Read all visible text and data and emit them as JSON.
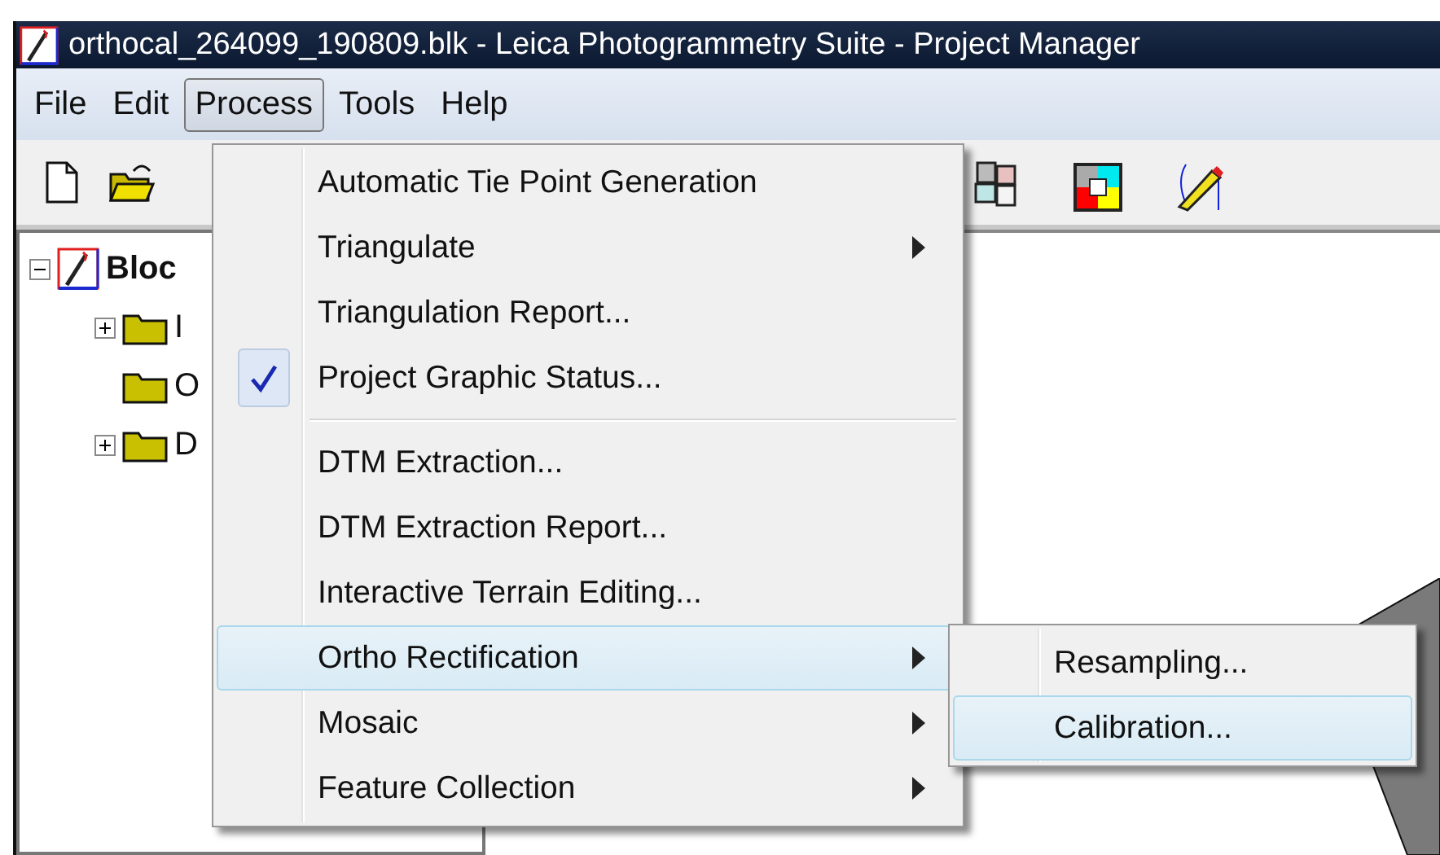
{
  "window": {
    "title": "orthocal_264099_190809.blk - Leica Photogrammetry Suite - Project Manager"
  },
  "menubar": [
    {
      "label": "File",
      "selected": false
    },
    {
      "label": "Edit",
      "selected": false
    },
    {
      "label": "Process",
      "selected": true
    },
    {
      "label": "Tools",
      "selected": false
    },
    {
      "label": "Help",
      "selected": false
    }
  ],
  "tree": {
    "label": "Bloc",
    "expanded": true,
    "children": [
      {
        "label": "I",
        "expanded": false,
        "has_children": true
      },
      {
        "label": "O",
        "has_children": false
      },
      {
        "label": "D",
        "expanded": false,
        "has_children": true
      }
    ]
  },
  "process_menu": [
    {
      "kind": "item",
      "label": "Automatic Tie Point Generation",
      "checked": false,
      "submenu": false,
      "selected": false
    },
    {
      "kind": "item",
      "label": "Triangulate",
      "checked": false,
      "submenu": true,
      "selected": false
    },
    {
      "kind": "item",
      "label": "Triangulation Report...",
      "checked": false,
      "submenu": false,
      "selected": false
    },
    {
      "kind": "item",
      "label": "Project Graphic Status...",
      "checked": true,
      "submenu": false,
      "selected": false
    },
    {
      "kind": "separator"
    },
    {
      "kind": "item",
      "label": "DTM Extraction...",
      "checked": false,
      "submenu": false,
      "selected": false
    },
    {
      "kind": "item",
      "label": "DTM Extraction Report...",
      "checked": false,
      "submenu": false,
      "selected": false
    },
    {
      "kind": "item",
      "label": "Interactive Terrain Editing...",
      "checked": false,
      "submenu": false,
      "selected": false
    },
    {
      "kind": "item",
      "label": "Ortho Rectification",
      "checked": false,
      "submenu": true,
      "selected": true
    },
    {
      "kind": "item",
      "label": "Mosaic",
      "checked": false,
      "submenu": true,
      "selected": false
    },
    {
      "kind": "item",
      "label": "Feature Collection",
      "checked": false,
      "submenu": true,
      "selected": false
    }
  ],
  "ortho_submenu": [
    {
      "label": "Resampling...",
      "selected": false
    },
    {
      "label": "Calibration...",
      "selected": true
    }
  ]
}
